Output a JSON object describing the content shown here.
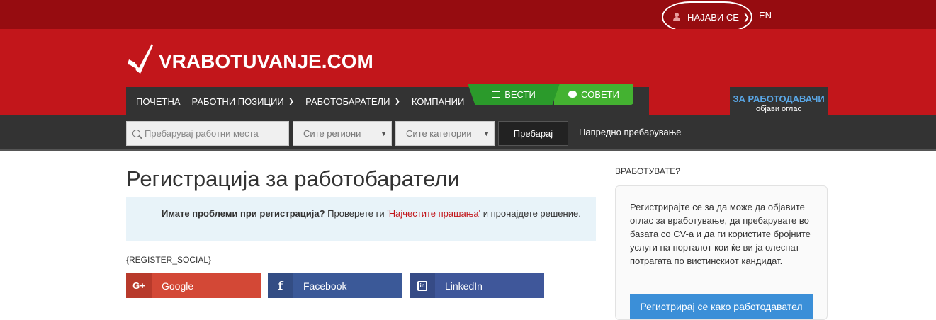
{
  "topbar": {
    "login_label": "НАЈАВИ СЕ",
    "lang_label": "EN"
  },
  "logo": {
    "text": "VRABOTUVANJE.COM"
  },
  "nav": {
    "items": [
      {
        "label": "ПОЧЕТНА"
      },
      {
        "label": "РАБОТНИ ПОЗИЦИИ"
      },
      {
        "label": "РАБОТОБАРАТЕЛИ"
      },
      {
        "label": "КОМПАНИИ"
      }
    ],
    "news_label": "ВЕСТИ",
    "tips_label": "СОВЕТИ",
    "employers_title": "ЗА РАБОТОДАВАЧИ",
    "employers_sub": "објави оглас"
  },
  "search": {
    "placeholder": "Пребарувај работни места",
    "region": "Сите региони",
    "category": "Сите категории",
    "button_label": "Пребарај",
    "advanced_label": "Напредно пребарување"
  },
  "main": {
    "title": "Регистрација за работобаратели",
    "info_bold": "Имате проблеми при регистрација?",
    "info_pre": "Проверете ги",
    "info_link": "'Најчестите прашања'",
    "info_post": "и пронајдете решение.",
    "register_social": "{REGISTER_SOCIAL}",
    "social": {
      "google": "Google",
      "facebook": "Facebook",
      "linkedin": "LinkedIn"
    }
  },
  "sidebar": {
    "title": "ВРАБОТУВАТЕ?",
    "text": "Регистрирајте се за да може да објавите оглас за вработување, да пребарувате во базата со CV-а и да ги користите бројните услуги на порталот кои ќе ви ја олеснат потрагата по вистинскиот кандидат.",
    "button_label": "Регистрирај се како работодавател"
  },
  "colors": {
    "brand_red": "#c2161b",
    "dark_red": "#960c10",
    "nav_dark": "#333333",
    "green": "#44b231",
    "blue": "#3b8fd8"
  }
}
